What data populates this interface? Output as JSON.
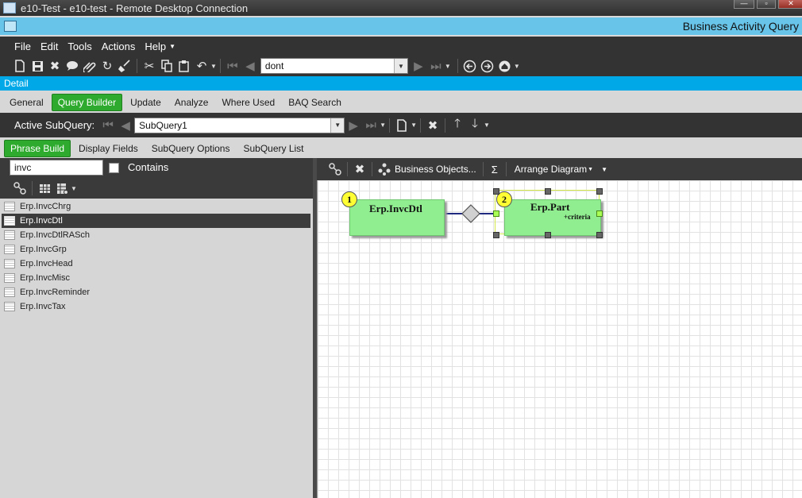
{
  "rdp": {
    "title": "e10-Test - e10-test - Remote Desktop Connection"
  },
  "app": {
    "title": "Business Activity Query"
  },
  "menu": [
    "File",
    "Edit",
    "Tools",
    "Actions",
    "Help"
  ],
  "toolbar": {
    "search_value": "dont"
  },
  "detail_label": "Detail",
  "tabs": [
    "General",
    "Query Builder",
    "Update",
    "Analyze",
    "Where Used",
    "BAQ Search"
  ],
  "active_tab": "Query Builder",
  "subquery": {
    "label": "Active SubQuery:",
    "value": "SubQuery1"
  },
  "subtabs": [
    "Phrase Build",
    "Display Fields",
    "SubQuery Options",
    "SubQuery List"
  ],
  "active_subtab": "Phrase Build",
  "filter": {
    "value": "invc",
    "contains_label": "Contains",
    "contains_checked": false
  },
  "tables": [
    "Erp.InvcChrg",
    "Erp.InvcDtl",
    "Erp.InvcDtlRASch",
    "Erp.InvcGrp",
    "Erp.InvcHead",
    "Erp.InvcMisc",
    "Erp.InvcReminder",
    "Erp.InvcTax"
  ],
  "selected_table": "Erp.InvcDtl",
  "diagram_toolbar": {
    "business_objects": "Business Objects...",
    "sigma": "Σ",
    "arrange": "Arrange Diagram"
  },
  "diagram": {
    "table1": {
      "badge": "1",
      "name": "Erp.InvcDtl"
    },
    "table2": {
      "badge": "2",
      "name": "Erp.Part",
      "criteria": "+criteria"
    }
  },
  "colors": {
    "accent_blue": "#00a8e8",
    "title_blue": "#68c4e9",
    "active_green": "#2eaa2e",
    "table_green": "#90ee90",
    "badge_yellow": "#ffff33"
  }
}
